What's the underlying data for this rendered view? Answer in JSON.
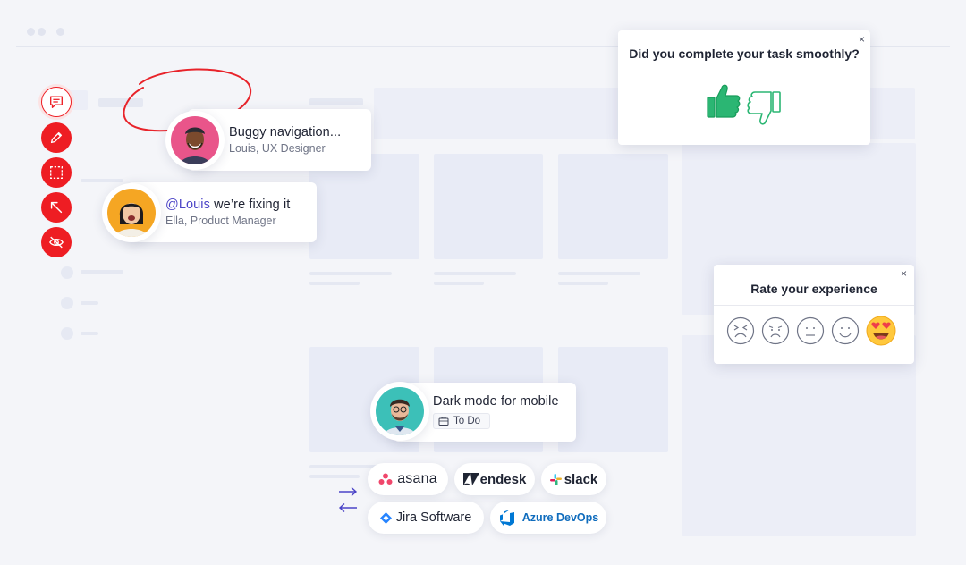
{
  "comments": [
    {
      "text": "Buggy navigation...",
      "author": "Louis, UX Designer"
    },
    {
      "mention": "@Louis",
      "text": " we’re fixing it",
      "author": "Ella, Product Manager"
    }
  ],
  "task": {
    "title": "Dark mode for mobile",
    "status": "To Do"
  },
  "surveys": {
    "task": {
      "question": "Did you complete your task smoothly?",
      "close": "×"
    },
    "rating": {
      "question": "Rate your experience",
      "close": "×",
      "selected_index": 4
    }
  },
  "integrations": {
    "asana": "asana",
    "zendesk": "endesk",
    "slack": "slack",
    "jira": "Jira Software",
    "azure": "Azure DevOps"
  },
  "colors": {
    "accent_red": "#ee1d23",
    "mention_purple": "#4b44c7",
    "thumbs_green": "#2bb673",
    "arrows": "#4b44c7"
  },
  "toolbar": [
    "comment-icon",
    "pencil-icon",
    "selection-icon",
    "arrow-icon",
    "hide-icon"
  ]
}
